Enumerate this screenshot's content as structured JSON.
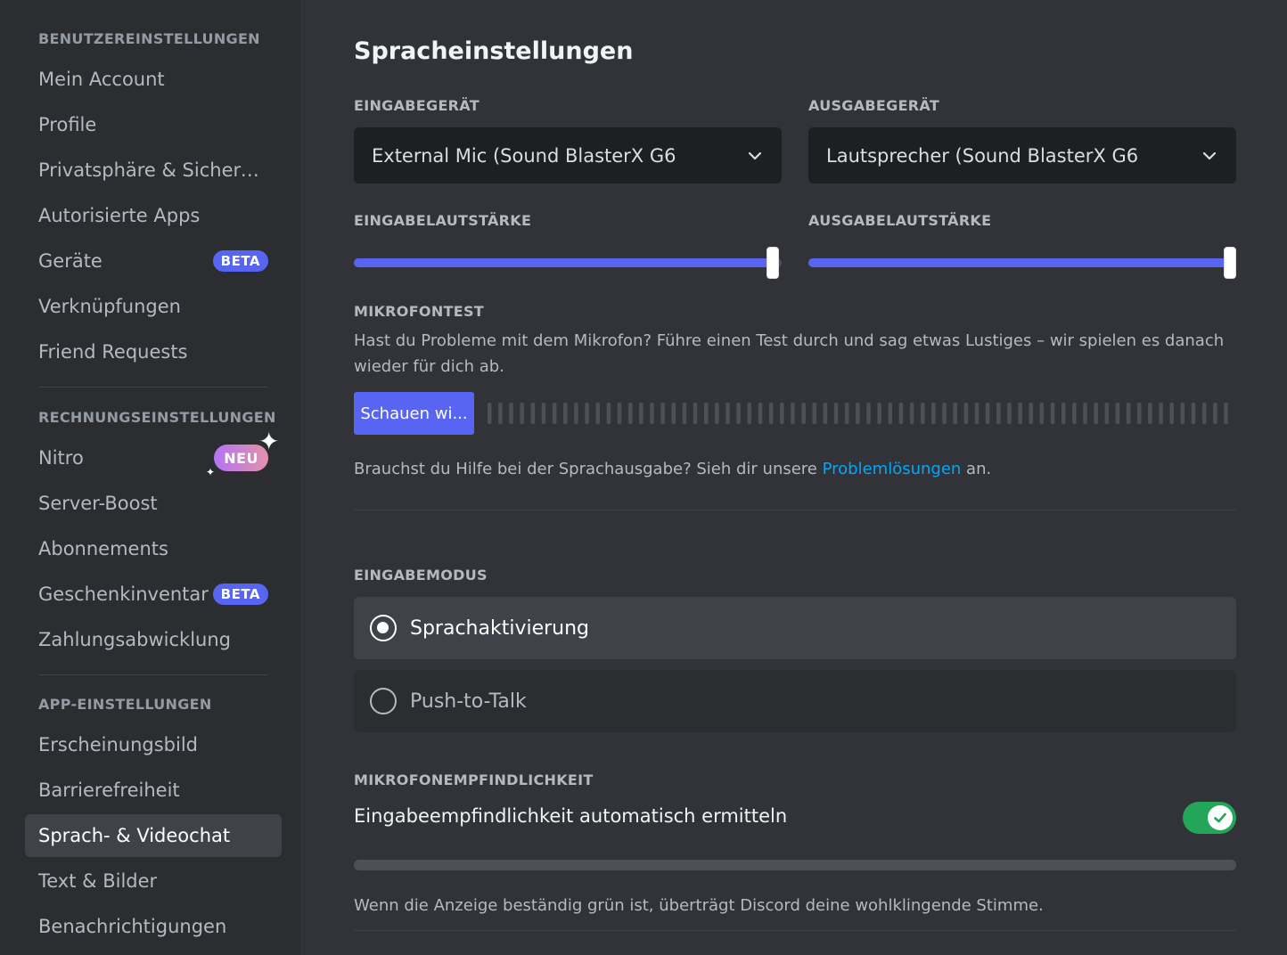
{
  "sidebar": {
    "sections": [
      {
        "header": "BENUTZEREINSTELLUNGEN",
        "items": [
          {
            "label": "Mein Account"
          },
          {
            "label": "Profile"
          },
          {
            "label": "Privatsphäre & Sicherh..."
          },
          {
            "label": "Autorisierte Apps"
          },
          {
            "label": "Geräte",
            "badge": "BETA"
          },
          {
            "label": "Verknüpfungen"
          },
          {
            "label": "Friend Requests"
          }
        ]
      },
      {
        "header": "RECHNUNGSEINSTELLUNGEN",
        "items": [
          {
            "label": "Nitro",
            "badge": "NEU"
          },
          {
            "label": "Server-Boost"
          },
          {
            "label": "Abonnements"
          },
          {
            "label": "Geschenkinventar",
            "badge": "BETA"
          },
          {
            "label": "Zahlungsabwicklung"
          }
        ]
      },
      {
        "header": "APP-EINSTELLUNGEN",
        "items": [
          {
            "label": "Erscheinungsbild"
          },
          {
            "label": "Barrierefreiheit"
          },
          {
            "label": "Sprach- & Videochat",
            "active": true
          },
          {
            "label": "Text & Bilder"
          },
          {
            "label": "Benachrichtigungen"
          }
        ]
      }
    ]
  },
  "main": {
    "title": "Spracheinstellungen",
    "input_device": {
      "label": "EINGABEGERÄT",
      "value": "External Mic (Sound BlasterX G6",
      "icon": "chevron-down-icon"
    },
    "output_device": {
      "label": "AUSGABEGERÄT",
      "value": "Lautsprecher (Sound BlasterX G6",
      "icon": "chevron-down-icon"
    },
    "input_volume": {
      "label": "EINGABELAUTSTÄRKE",
      "value_percent": 98
    },
    "output_volume": {
      "label": "AUSGABELAUTSTÄRKE",
      "value_percent": 100
    },
    "mic_test": {
      "label": "MIKROFONTEST",
      "description": "Hast du Probleme mit dem Mikrofon? Führe einen Test durch und sag etwas Lustiges – wir spielen es danach wieder für dich ab.",
      "button": "Schauen wi..."
    },
    "help": {
      "prefix": "Brauchst du Hilfe bei der Sprachausgabe? Sieh dir unsere ",
      "link": "Problemlösungen",
      "suffix": " an."
    },
    "input_mode": {
      "label": "EINGABEMODUS",
      "options": [
        {
          "label": "Sprachaktivierung",
          "selected": true
        },
        {
          "label": "Push-to-Talk",
          "selected": false
        }
      ]
    },
    "sensitivity": {
      "label": "MIKROFONEMPFINDLICHKEIT",
      "auto_label": "Eingabeempfindlichkeit automatisch ermitteln",
      "auto_enabled": true,
      "hint": "Wenn die Anzeige beständig grün ist, überträgt Discord deine wohlklingende Stimme."
    }
  },
  "colors": {
    "accent": "#5865f2",
    "toggle_on": "#23a55a",
    "link": "#00a8fc"
  }
}
